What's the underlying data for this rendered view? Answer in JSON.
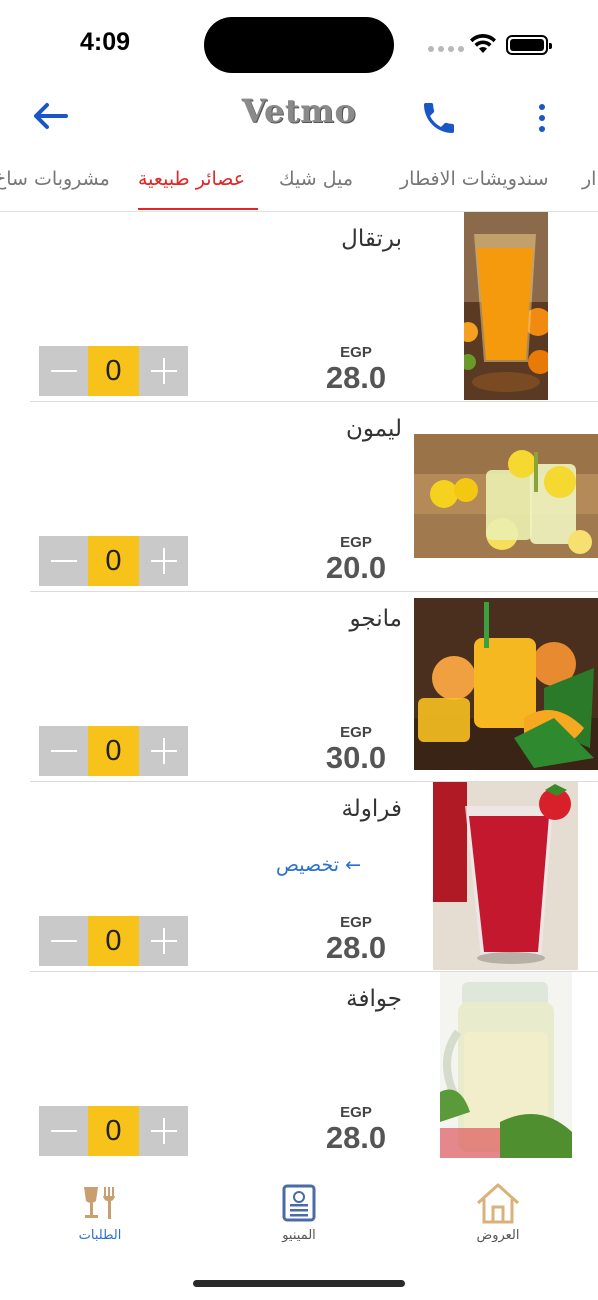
{
  "status_bar": {
    "time": "4:09"
  },
  "header": {
    "logo_text": "Vetmo",
    "back_icon": "arrow-left-icon",
    "call_icon": "phone-icon",
    "more_icon": "more-vertical-icon",
    "accent_color": "#1a56c8"
  },
  "tabs": [
    {
      "label": "ار"
    },
    {
      "label": "سندويشات الافطار"
    },
    {
      "label": "ميل شيك"
    },
    {
      "label": "عصائر طبيعية",
      "active": true
    },
    {
      "label": "مشروبات ساخ"
    }
  ],
  "items": [
    {
      "name": "برتقال",
      "currency": "EGP",
      "price": "28.0",
      "quantity": "0",
      "image": "orange-juice"
    },
    {
      "name": "ليمون",
      "currency": "EGP",
      "price": "20.0",
      "quantity": "0",
      "image": "lemon-juice"
    },
    {
      "name": "مانجو",
      "currency": "EGP",
      "price": "30.0",
      "quantity": "0",
      "image": "mango-juice"
    },
    {
      "name": "فراولة",
      "currency": "EGP",
      "price": "28.0",
      "quantity": "0",
      "image": "strawberry-juice",
      "customize": "تخصيص ←"
    },
    {
      "name": "جوافة",
      "currency": "EGP",
      "price": "28.0",
      "quantity": "0",
      "image": "guava-juice"
    }
  ],
  "bottom_nav": [
    {
      "label": "الطلبات",
      "icon": "food-orders-icon",
      "active": true
    },
    {
      "label": "المينيو",
      "icon": "menu-book-icon"
    },
    {
      "label": "العروض",
      "icon": "home-icon"
    }
  ],
  "colors": {
    "active_tab": "#e32626",
    "stepper_value_bg": "#f7c21a",
    "stepper_btn_bg": "#c9c9c9",
    "link": "#2a6fd6"
  }
}
